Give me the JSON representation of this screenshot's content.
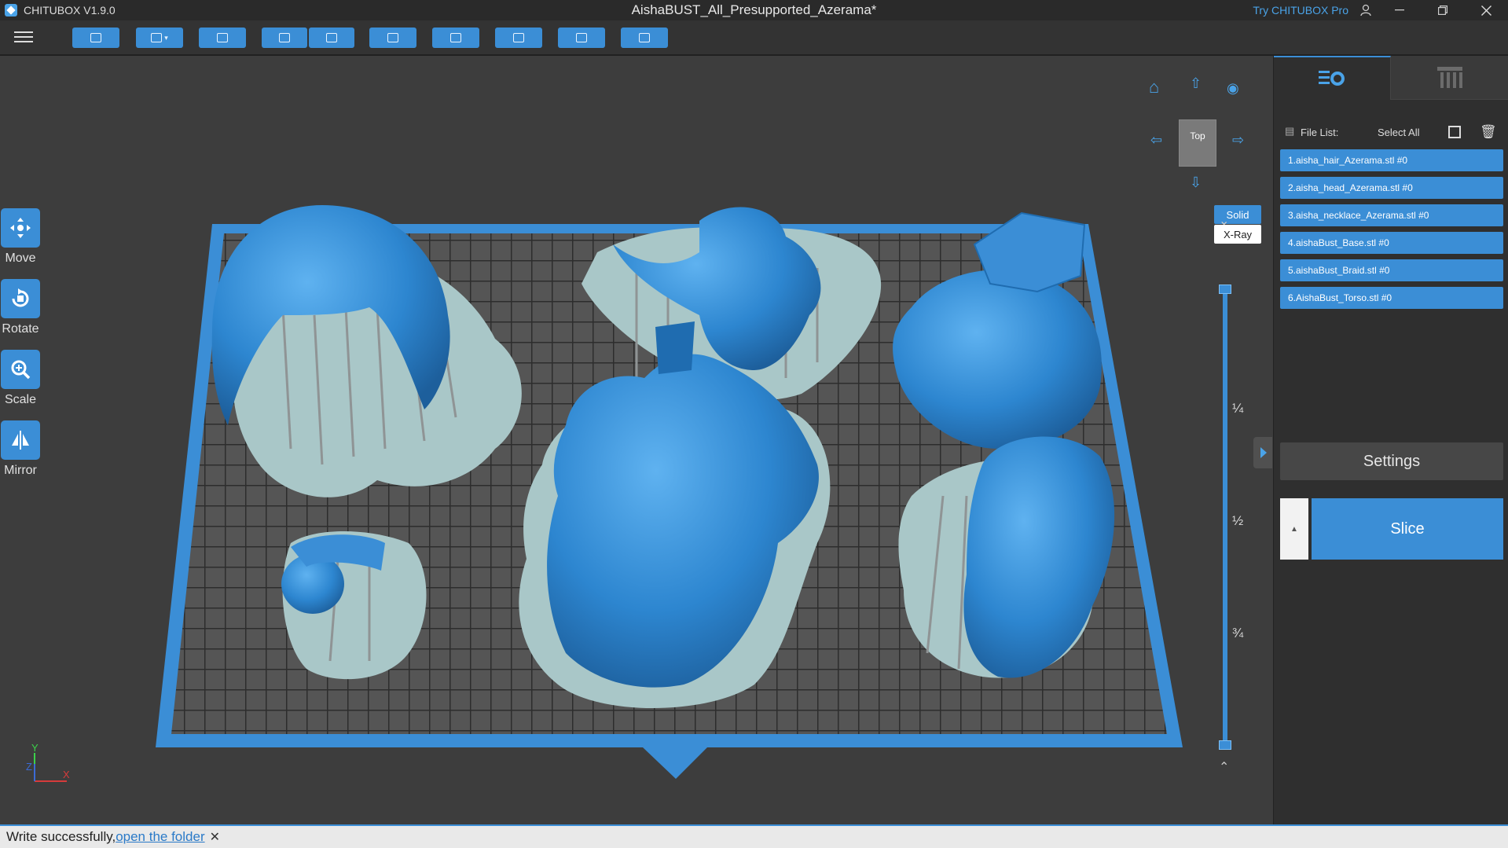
{
  "window": {
    "app_name": "CHITUBOX V1.9.0",
    "document_title": "AishaBUST_All_Presupported_Azerama*",
    "try_pro": "Try CHITUBOX Pro"
  },
  "toolbar": {
    "buttons": [
      "open-file",
      "save",
      "auto-layout",
      "undo",
      "redo",
      "layout",
      "duplicate",
      "support",
      "hollow",
      "dig-hole"
    ]
  },
  "tools": [
    {
      "label": "Move",
      "icon": "move-icon"
    },
    {
      "label": "Rotate",
      "icon": "rotate-icon"
    },
    {
      "label": "Scale",
      "icon": "scale-icon"
    },
    {
      "label": "Mirror",
      "icon": "mirror-icon"
    }
  ],
  "view": {
    "cube_label": "Top",
    "solid": "Solid",
    "xray": "X-Ray"
  },
  "layer_slider": {
    "marks": [
      "¼",
      "½",
      "¾"
    ]
  },
  "axes": {
    "x": "X",
    "y": "Y",
    "z": "Z"
  },
  "panel": {
    "file_list_label": "File List:",
    "select_all": "Select All",
    "files": [
      "1.aisha_hair_Azerama.stl #0",
      "2.aisha_head_Azerama.stl #0",
      "3.aisha_necklace_Azerama.stl #0",
      "4.aishaBust_Base.stl #0",
      "5.aishaBust_Braid.stl #0",
      "6.AishaBust_Torso.stl #0"
    ],
    "settings": "Settings",
    "slice": "Slice"
  },
  "status": {
    "message": "Write successfully,",
    "link": "open the folder"
  },
  "colors": {
    "accent": "#3b8ed6",
    "model": "#2f86d0",
    "raft": "#a9c7c8",
    "plate": "#535353"
  }
}
